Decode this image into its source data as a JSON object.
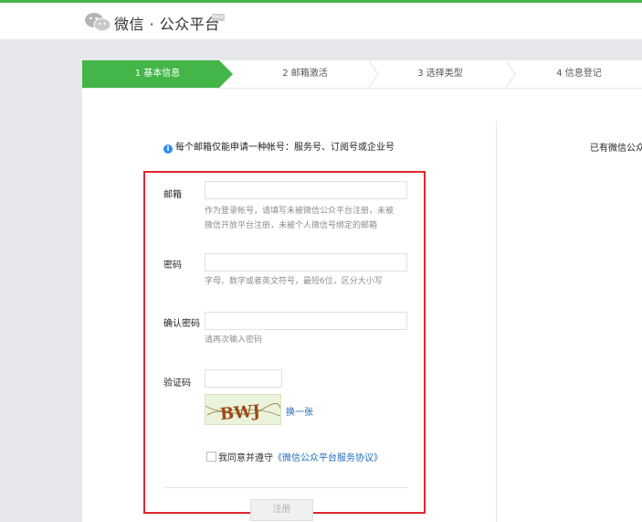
{
  "header": {
    "title": "微信 · 公众平台",
    "beta": "Beta"
  },
  "steps": [
    "1 基本信息",
    "2 邮箱激活",
    "3 选择类型",
    "4 信息登记"
  ],
  "notice": "每个邮箱仅能申请一种帐号：服务号、订阅号或企业号",
  "side_text": "已有微信公众",
  "form": {
    "email_label": "邮箱",
    "email_hint": "作为登录帐号，请填写未被微信公众平台注册，未被微信开放平台注册，未被个人微信号绑定的邮箱",
    "password_label": "密码",
    "password_hint": "字母、数字或者英文符号，最短6位，区分大小写",
    "confirm_label": "确认密码",
    "confirm_hint": "请再次输入密码",
    "captcha_label": "验证码",
    "captcha_text": "BWJ",
    "refresh_label": "换一张",
    "agree_text": "我同意并遵守",
    "agree_link": "《微信公众平台服务协议》",
    "register_label": "注册"
  },
  "colors": {
    "accent": "#44b549",
    "highlight_box": "#e0282e",
    "link": "#1e6bb8"
  }
}
